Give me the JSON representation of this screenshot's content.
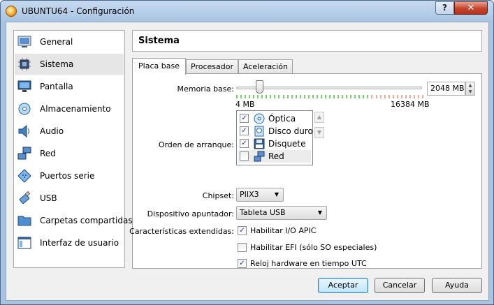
{
  "window": {
    "title": "UBUNTU64 - Configuración",
    "help_glyph": "?",
    "close_glyph": "✕"
  },
  "sidebar": {
    "items": [
      {
        "label": "General",
        "icon": "general-icon",
        "selected": false
      },
      {
        "label": "Sistema",
        "icon": "system-chip-icon",
        "selected": true
      },
      {
        "label": "Pantalla",
        "icon": "display-monitor-icon",
        "selected": false
      },
      {
        "label": "Almacenamiento",
        "icon": "storage-disc-icon",
        "selected": false
      },
      {
        "label": "Audio",
        "icon": "speaker-icon",
        "selected": false
      },
      {
        "label": "Red",
        "icon": "network-icon",
        "selected": false
      },
      {
        "label": "Puertos serie",
        "icon": "serial-port-icon",
        "selected": false
      },
      {
        "label": "USB",
        "icon": "usb-icon",
        "selected": false
      },
      {
        "label": "Carpetas compartidas",
        "icon": "shared-folder-icon",
        "selected": false
      },
      {
        "label": "Interfaz de usuario",
        "icon": "user-interface-icon",
        "selected": false
      }
    ]
  },
  "panel": {
    "title": "Sistema"
  },
  "tabs": [
    {
      "label": "Placa base",
      "active": true
    },
    {
      "label": "Procesador",
      "active": false
    },
    {
      "label": "Aceleración",
      "active": false
    }
  ],
  "motherboard": {
    "memory_label": "Memoria base:",
    "memory_value": "2048 MB",
    "memory_min": "4 MB",
    "memory_max": "16384 MB",
    "memory_fraction": 0.125,
    "boot_label": "Orden de arranque:",
    "boot_items": [
      {
        "label": "Óptica",
        "checked": true,
        "icon": "optical-disc-icon"
      },
      {
        "label": "Disco duro",
        "checked": true,
        "icon": "hard-disk-icon"
      },
      {
        "label": "Disquete",
        "checked": true,
        "icon": "floppy-icon"
      },
      {
        "label": "Red",
        "checked": false,
        "icon": "network-icon"
      }
    ],
    "chipset_label": "Chipset:",
    "chipset_value": "PIIX3",
    "pointing_label": "Dispositivo apuntador:",
    "pointing_value": "Tableta USB",
    "features_label": "Características extendidas:",
    "features": [
      {
        "label": "Habilitar I/O APIC",
        "checked": true
      },
      {
        "label": "Habilitar EFI (sólo SO especiales)",
        "checked": false
      },
      {
        "label": "Reloj hardware en tiempo UTC",
        "checked": true
      }
    ]
  },
  "buttons": {
    "accept": "Aceptar",
    "cancel": "Cancelar",
    "help": "Ayuda"
  },
  "colors": {
    "safe_tick": "#7ad06c",
    "warn_tick": "#f0a8a0"
  }
}
